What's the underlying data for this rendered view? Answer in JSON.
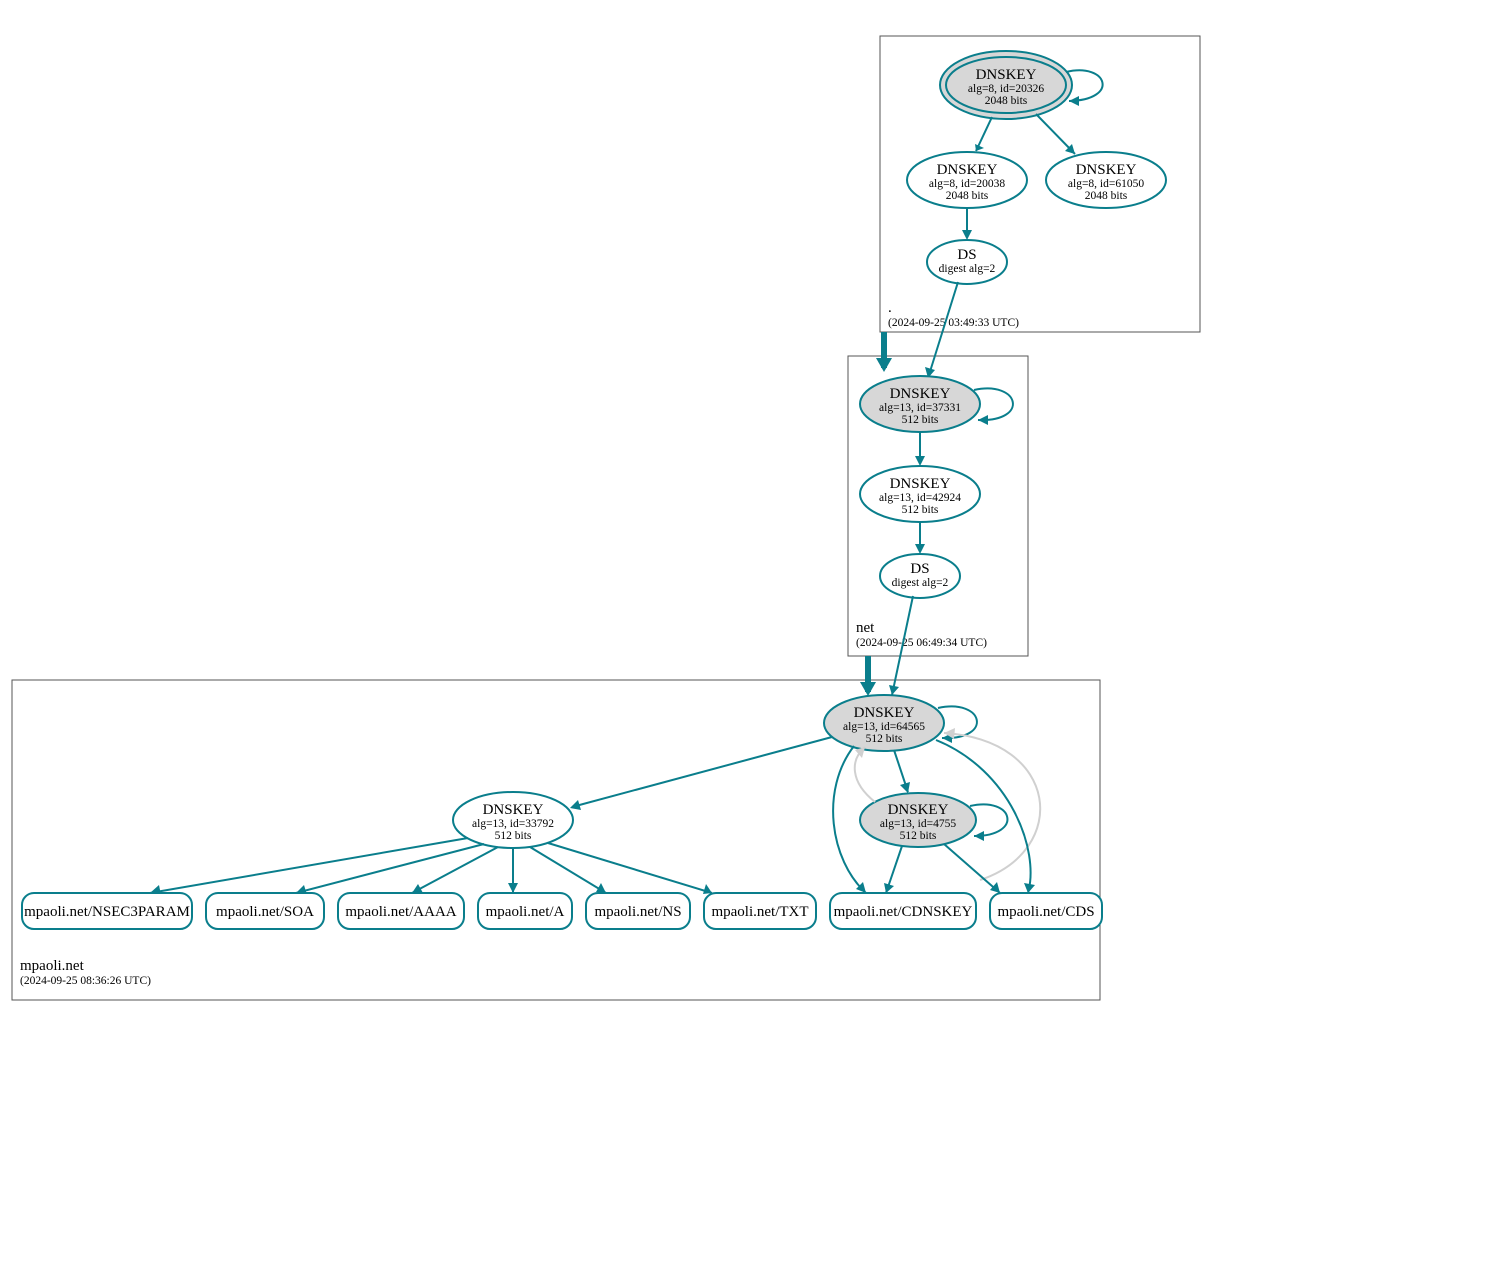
{
  "colors": {
    "stroke": "#0a7e8c",
    "fillGrey": "#d7d7d7",
    "light": "#d0d0d0"
  },
  "zones": {
    "root": {
      "label": ".",
      "timestamp": "(2024-09-25 03:49:33 UTC)"
    },
    "net": {
      "label": "net",
      "timestamp": "(2024-09-25 06:49:34 UTC)"
    },
    "mpaoli": {
      "label": "mpaoli.net",
      "timestamp": "(2024-09-25 08:36:26 UTC)"
    }
  },
  "nodes": {
    "root_ksk": {
      "l1": "DNSKEY",
      "l2": "alg=8, id=20326",
      "l3": "2048 bits"
    },
    "root_zsk1": {
      "l1": "DNSKEY",
      "l2": "alg=8, id=20038",
      "l3": "2048 bits"
    },
    "root_zsk2": {
      "l1": "DNSKEY",
      "l2": "alg=8, id=61050",
      "l3": "2048 bits"
    },
    "root_ds": {
      "l1": "DS",
      "l2": "digest alg=2"
    },
    "net_ksk": {
      "l1": "DNSKEY",
      "l2": "alg=13, id=37331",
      "l3": "512 bits"
    },
    "net_zsk": {
      "l1": "DNSKEY",
      "l2": "alg=13, id=42924",
      "l3": "512 bits"
    },
    "net_ds": {
      "l1": "DS",
      "l2": "digest alg=2"
    },
    "mp_ksk": {
      "l1": "DNSKEY",
      "l2": "alg=13, id=64565",
      "l3": "512 bits"
    },
    "mp_zsk2": {
      "l1": "DNSKEY",
      "l2": "alg=13, id=4755",
      "l3": "512 bits"
    },
    "mp_zsk1": {
      "l1": "DNSKEY",
      "l2": "alg=13, id=33792",
      "l3": "512 bits"
    }
  },
  "records": {
    "r1": "mpaoli.net/NSEC3PARAM",
    "r2": "mpaoli.net/SOA",
    "r3": "mpaoli.net/AAAA",
    "r4": "mpaoli.net/A",
    "r5": "mpaoli.net/NS",
    "r6": "mpaoli.net/TXT",
    "r7": "mpaoli.net/CDNSKEY",
    "r8": "mpaoli.net/CDS"
  }
}
